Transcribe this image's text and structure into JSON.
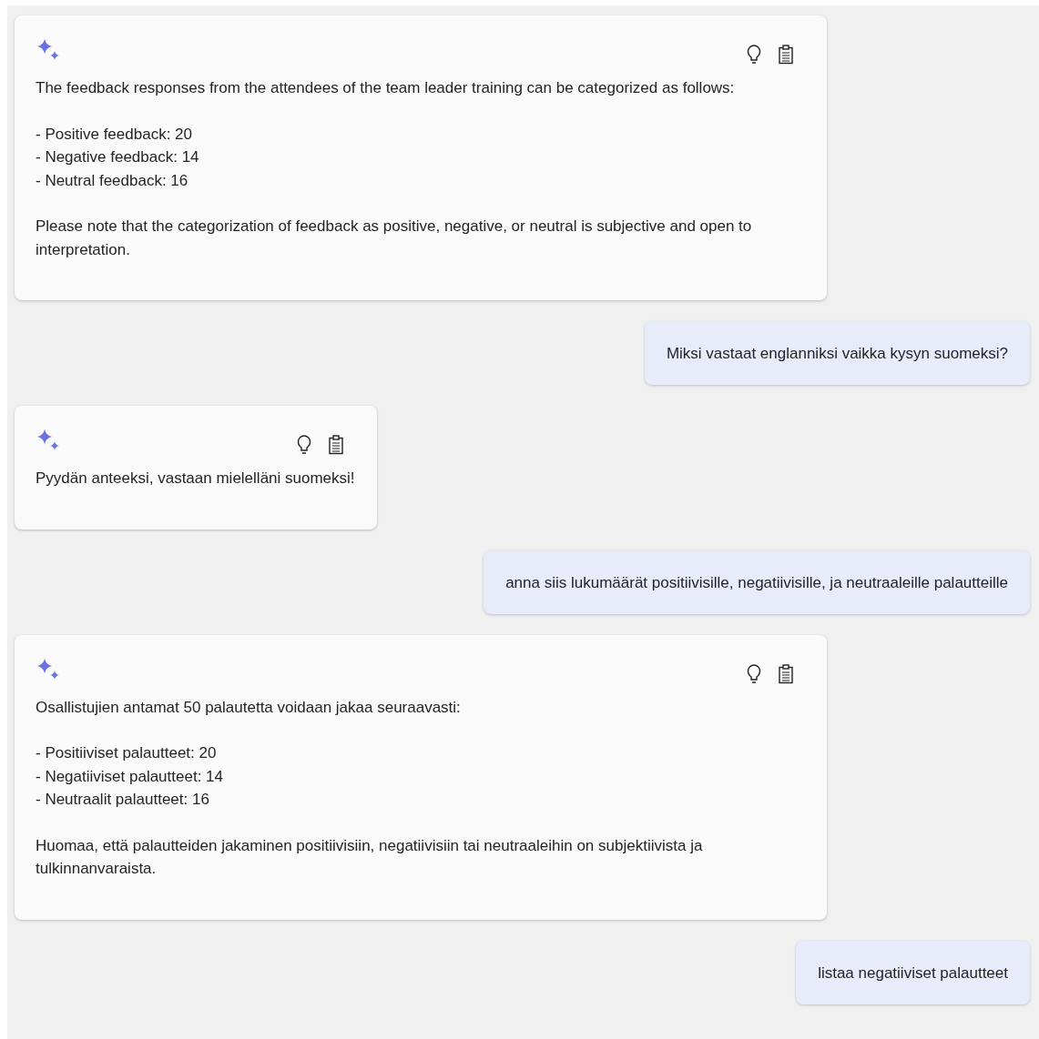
{
  "messages": [
    {
      "kind": "bot",
      "blocks": [
        {
          "kind": "text",
          "text": "The feedback responses from the attendees of the team leader training can be categorized as follows:"
        },
        {
          "kind": "list",
          "items": [
            "- Positive feedback: 20",
            "- Negative feedback: 14",
            "- Neutral feedback: 16"
          ]
        },
        {
          "kind": "text",
          "text": "Please note that the categorization of feedback as positive, negative, or neutral is subjective and open to interpretation."
        }
      ]
    },
    {
      "kind": "user",
      "text": "Miksi vastaat englanniksi vaikka kysyn suomeksi?"
    },
    {
      "kind": "bot",
      "blocks": [
        {
          "kind": "text",
          "text": "Pyydän anteeksi, vastaan mielelläni suomeksi!"
        }
      ]
    },
    {
      "kind": "user",
      "text": "anna siis lukumäärät positiivisille, negatiivisille, ja neutraaleille palautteille"
    },
    {
      "kind": "bot",
      "blocks": [
        {
          "kind": "text",
          "text": "Osallistujien antamat 50 palautetta voidaan jakaa seuraavasti:"
        },
        {
          "kind": "list",
          "items": [
            "- Positiiviset palautteet: 20",
            "- Negatiiviset palautteet: 14",
            "- Neutraalit palautteet: 16"
          ]
        },
        {
          "kind": "text",
          "text": "Huomaa, että palautteiden jakaminen positiivisiin, negatiivisiin tai neutraaleihin on subjektiivista ja tulkinnanvaraista."
        }
      ]
    },
    {
      "kind": "user",
      "text": "listaa negatiiviset palautteet"
    }
  ]
}
